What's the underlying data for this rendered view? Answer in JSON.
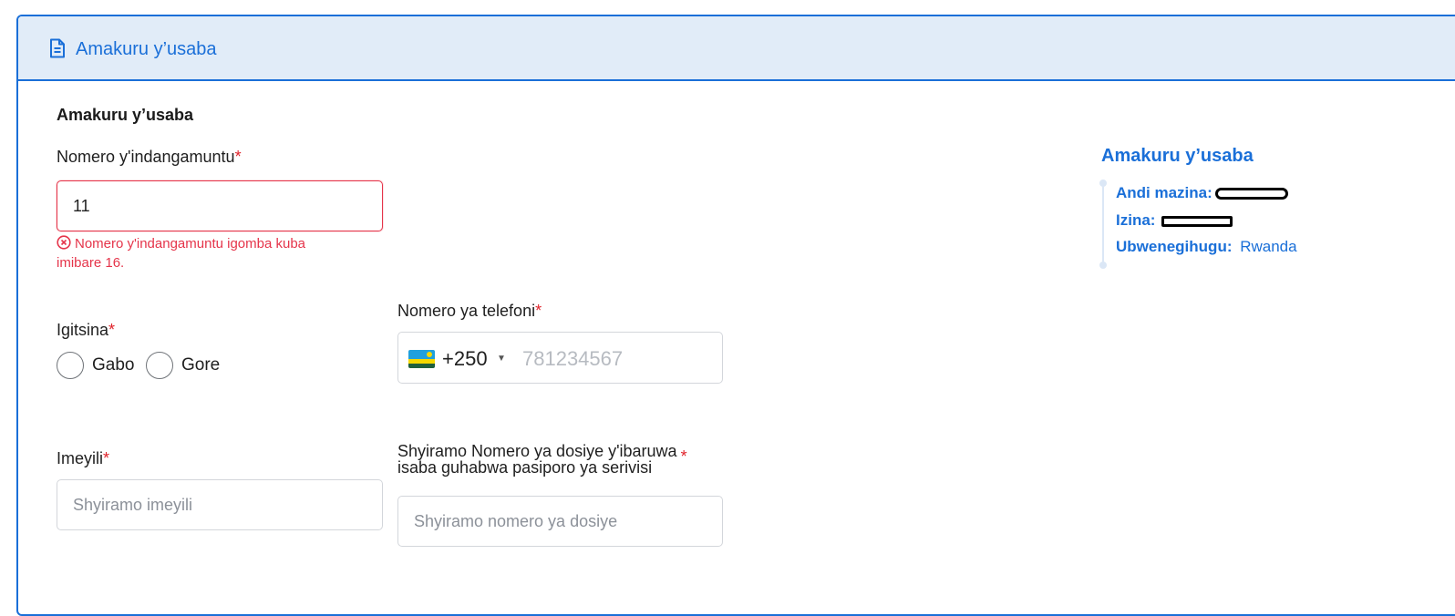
{
  "header": {
    "title": "Amakuru y’usaba",
    "icon": "document-icon",
    "accent_color": "#1a6fd8",
    "background_color": "#e1ecf8"
  },
  "form": {
    "section_title": "Amakuru y’usaba",
    "id_number": {
      "label": "Nomero y'indangamuntu",
      "required_mark": "*",
      "value": "11",
      "error_line1": "Nomero y'indangamuntu igomba kuba",
      "error_line2": "imibare 16.",
      "error_icon": "error-circle-icon"
    },
    "gender": {
      "label": "Igitsina",
      "required_mark": "*",
      "options": [
        "Gabo",
        "Gore"
      ]
    },
    "phone": {
      "label": "Nomero ya telefoni",
      "required_mark": "*",
      "country_flag": "rwanda-flag-icon",
      "dial_code": "+250",
      "placeholder": "781234567"
    },
    "email": {
      "label": "Imeyili",
      "required_mark": "*",
      "placeholder": "Shyiramo imeyili"
    },
    "file_number": {
      "label_line1": "Shyiramo Nomero ya dosiye y'ibaruwa",
      "label_line2": "isaba guhabwa pasiporo ya serivisi",
      "required_mark": "*",
      "placeholder": "Shyiramo nomero ya dosiye"
    }
  },
  "summary": {
    "title": "Amakuru y’usaba",
    "rows": [
      {
        "key": "Andi mazina:",
        "value": ""
      },
      {
        "key": "Izina:",
        "value": ""
      },
      {
        "key": "Ubwenegihugu:",
        "value": "Rwanda"
      }
    ]
  },
  "colors": {
    "error": "#e5344a",
    "required": "#e0232b",
    "accent": "#1a6fd8"
  }
}
